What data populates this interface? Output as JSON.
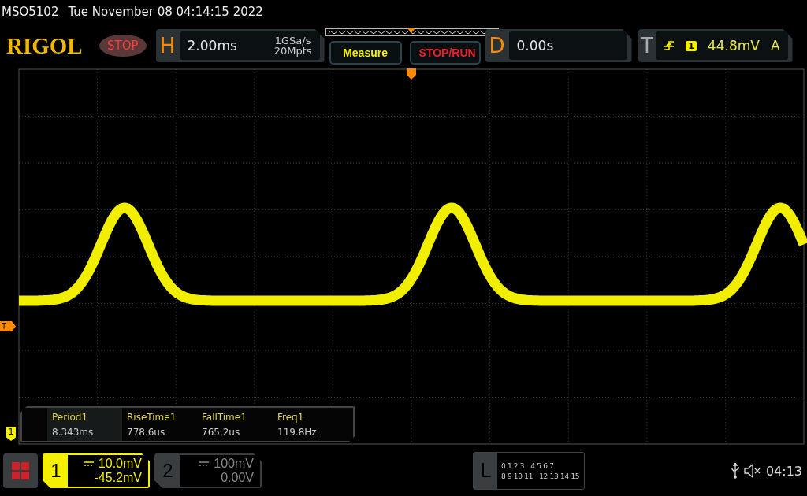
{
  "title_bar": {
    "model": "MSO5102",
    "datetime": "Tue November 08 04:14:15 2022"
  },
  "header": {
    "logo": "RIGOL",
    "run_state": "STOP",
    "horizontal": {
      "label": "H",
      "timebase": "2.00ms",
      "sample_rate": "1GSa/s",
      "memory_depth": "20Mpts"
    },
    "buttons": [
      {
        "label": "Measure",
        "kind": "measure"
      },
      {
        "label": "STOP/RUN",
        "kind": "stoprun"
      }
    ],
    "delay": {
      "label": "D",
      "value": "0.00s"
    },
    "trigger": {
      "label": "T",
      "source": "1",
      "level": "44.8mV",
      "mode": "A"
    }
  },
  "screen": {
    "trigger_marker": "T",
    "channel_marker": "1",
    "measurements": [
      {
        "name": "Period1",
        "value": "8.343ms"
      },
      {
        "name": "RiseTime1",
        "value": "778.6us"
      },
      {
        "name": "FallTime1",
        "value": "765.2us"
      },
      {
        "name": "Freq1",
        "value": "119.8Hz"
      }
    ]
  },
  "bottom_bar": {
    "channels": [
      {
        "number": "1",
        "scale": "10.0mV",
        "offset": "-45.2mV",
        "selected": true
      },
      {
        "number": "2",
        "scale": "100mV",
        "offset": "0.00V",
        "selected": false
      }
    ],
    "logic": {
      "label": "L",
      "rows": [
        [
          "0 1 2 3",
          "4 5 6 7"
        ],
        [
          "8 9 10 11",
          "12 13 14 15"
        ]
      ]
    },
    "time": "04:13"
  }
}
